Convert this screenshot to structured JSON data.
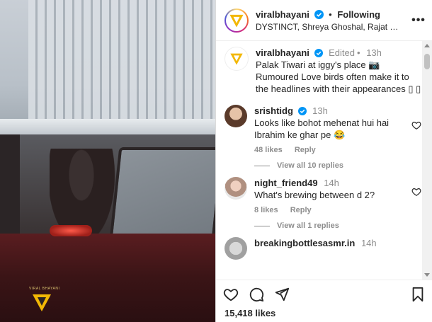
{
  "header": {
    "username": "viralbhayani",
    "follow_status": "Following",
    "separator": "•",
    "music": "DYSTINCT, Shreya Ghoshal, Rajat Nagpal..."
  },
  "caption": {
    "username": "viralbhayani",
    "edited": "Edited",
    "time": "13h",
    "text": "Palak Tiwari at iggy's place 📷 Rumoured Love birds often make it to the headlines with their appearances ▯ ▯"
  },
  "comments": [
    {
      "username": "srishtidg",
      "time": "13h",
      "text": "Looks like bohot mehenat hui hai Ibrahim ke ghar pe 😂",
      "likes": "48 likes",
      "reply": "Reply",
      "view_replies": "View all 10 replies"
    },
    {
      "username": "night_friend49",
      "time": "14h",
      "text": "What's brewing between d 2?",
      "likes": "8 likes",
      "reply": "Reply",
      "view_replies": "View all 1 replies"
    },
    {
      "username": "breakingbottlesasmr.in",
      "time": "14h"
    }
  ],
  "actions": {
    "likes_count": "15,418 likes"
  },
  "watermark": "VIRAL BHAYANI",
  "colors": {
    "verified": "#0095f6",
    "brand_yellow": "#f2b705",
    "muted_text": "#8e8e8e"
  }
}
